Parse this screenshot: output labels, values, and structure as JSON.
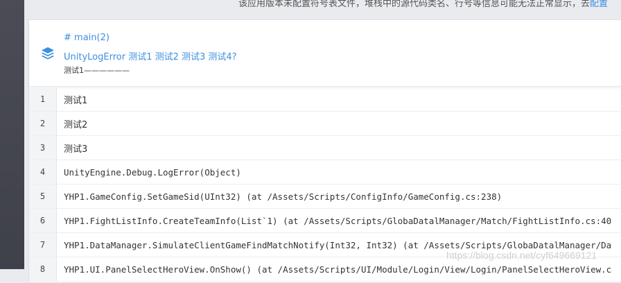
{
  "notice": {
    "text": "该应用版本未配置符号表文件，堆栈中的源代码类名、行号等信息可能无法正常显示，去",
    "link": "配置"
  },
  "issue": {
    "tag": "# main(2)",
    "title": "UnityLogError 测试1  测试2 测试3  测试4?",
    "subtitle": "测试1——————"
  },
  "stack": [
    {
      "line": "1",
      "text": "测试1"
    },
    {
      "line": "2",
      "text": "测试2"
    },
    {
      "line": "3",
      "text": "测试3"
    },
    {
      "line": "4",
      "text": "UnityEngine.Debug.LogError(Object)"
    },
    {
      "line": "5",
      "text": "YHP1.GameConfig.SetGameSid(UInt32) (at /Assets/Scripts/ConfigInfo/GameConfig.cs:238)"
    },
    {
      "line": "6",
      "text": "YHP1.FightListInfo.CreateTeamInfo(List`1) (at /Assets/Scripts/GlobaDatalManager/Match/FightListInfo.cs:40"
    },
    {
      "line": "7",
      "text": "YHP1.DataManager.SimulateClientGameFindMatchNotify(Int32, Int32) (at /Assets/Scripts/GlobaDatalManager/Da"
    },
    {
      "line": "8",
      "text": "YHP1.UI.PanelSelectHeroView.OnShow() (at /Assets/Scripts/UI/Module/Login/View/Login/PanelSelectHeroView.c"
    }
  ],
  "watermark": "https://blog.csdn.net/cyf649669121",
  "colors": {
    "accent": "#3d8fe0",
    "sidebar": "#45464f"
  }
}
